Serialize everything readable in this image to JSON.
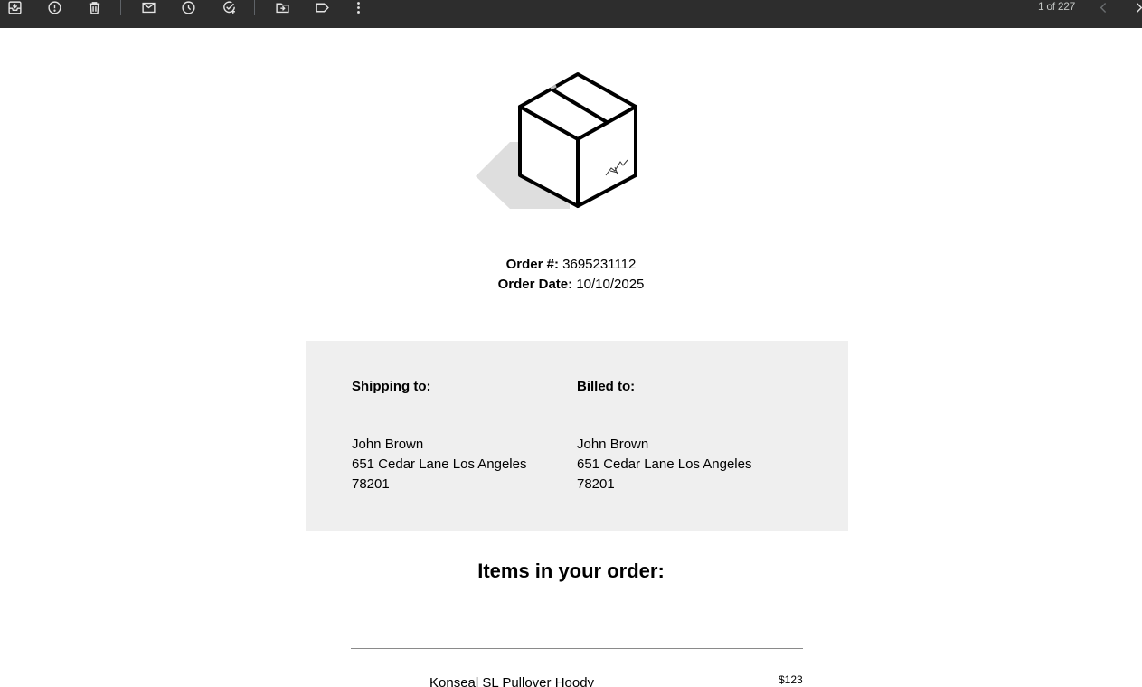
{
  "toolbar": {
    "buttons": [
      {
        "name": "archive-icon"
      },
      {
        "name": "report-spam-icon"
      },
      {
        "name": "delete-icon"
      },
      {
        "name": "mark-unread-icon"
      },
      {
        "name": "snooze-icon"
      },
      {
        "name": "add-task-icon"
      },
      {
        "name": "move-to-icon"
      },
      {
        "name": "label-icon"
      },
      {
        "name": "more-options-icon"
      }
    ],
    "pager_text": "1 of 227",
    "prev_icon": "chevron-left-icon",
    "next_icon": "chevron-right-icon"
  },
  "hero": {
    "icon": "package-box-icon"
  },
  "order": {
    "number_label": "Order #:",
    "number_value": "3695231112",
    "date_label": "Order Date:",
    "date_value": "10/10/2025"
  },
  "shipping": {
    "heading": "Shipping to:",
    "name": "John Brown",
    "street": "651 Cedar Lane Los Angeles",
    "zip": "78201"
  },
  "billing": {
    "heading": "Billed to:",
    "name": "John Brown",
    "street": "651 Cedar Lane Los Angeles",
    "zip": "78201"
  },
  "items": {
    "title": "Items in your order:",
    "list": [
      {
        "name": "Konseal SL Pullover Hoody",
        "price": "$123"
      }
    ]
  },
  "colors": {
    "toolbar_bg": "#2d2d2d",
    "toolbar_icon": "#e3e3e3",
    "panel_bg": "#efefef"
  }
}
